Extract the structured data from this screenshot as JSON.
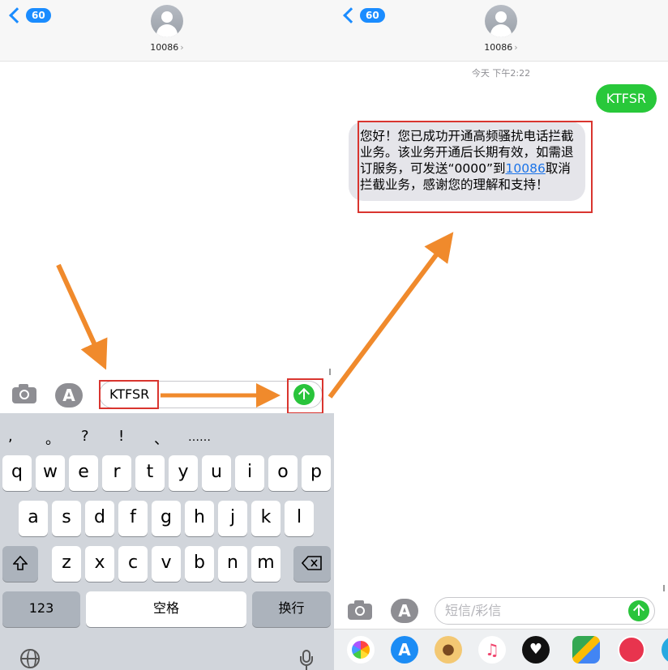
{
  "left": {
    "back_count": "60",
    "contact": "10086",
    "input_value": "KTFSR",
    "punctuation": [
      ",",
      "。",
      "?",
      "!",
      "、",
      "……"
    ],
    "row1": [
      "q",
      "w",
      "e",
      "r",
      "t",
      "y",
      "u",
      "i",
      "o",
      "p"
    ],
    "row2": [
      "a",
      "s",
      "d",
      "f",
      "g",
      "h",
      "j",
      "k",
      "l"
    ],
    "row3": [
      "z",
      "x",
      "c",
      "v",
      "b",
      "n",
      "m"
    ],
    "key_123": "123",
    "key_space": "空格",
    "key_return": "换行"
  },
  "right": {
    "back_count": "60",
    "contact": "10086",
    "timestamp": "今天 下午2:22",
    "sent_message": "KTFSR",
    "received_part1": "您好！您已成功开通高频骚扰电话拦截业务。该业务开通后长期有效，如需退订服务，可发送“0000”到",
    "received_link": "10086",
    "received_part2": "取消拦截业务，感谢您的理解和支持！",
    "input_placeholder": "短信/彩信"
  },
  "colors": {
    "accent_blue": "#1a8cff",
    "send_green": "#29c43b",
    "annotation_red": "#d9352f",
    "annotation_orange": "#f08a2c"
  },
  "icons": [
    "chevron-left-icon",
    "avatar-icon",
    "camera-icon",
    "app-store-icon",
    "send-arrow-icon",
    "shift-icon",
    "delete-icon",
    "globe-icon",
    "microphone-icon"
  ]
}
